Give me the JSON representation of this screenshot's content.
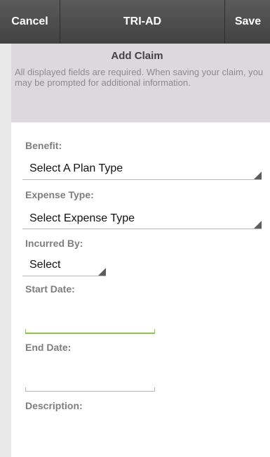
{
  "topbar": {
    "cancel_label": "Cancel",
    "title": "TRI-AD",
    "save_label": "Save"
  },
  "header": {
    "title": "Add Claim",
    "description": "All displayed fields are required.  When saving your claim, you may be prompted for additional information."
  },
  "form": {
    "benefit": {
      "label": "Benefit:",
      "value": "Select A Plan Type"
    },
    "expense_type": {
      "label": "Expense Type:",
      "value": "Select Expense Type"
    },
    "incurred_by": {
      "label": "Incurred By:",
      "value": "Select"
    },
    "start_date": {
      "label": "Start Date:",
      "value": ""
    },
    "end_date": {
      "label": "End Date:",
      "value": ""
    },
    "description": {
      "label": "Description:",
      "value": ""
    }
  },
  "colors": {
    "topbar": "#4b4b4b",
    "header_bg": "#ddd8dd",
    "focus_green": "#8ac83d"
  }
}
